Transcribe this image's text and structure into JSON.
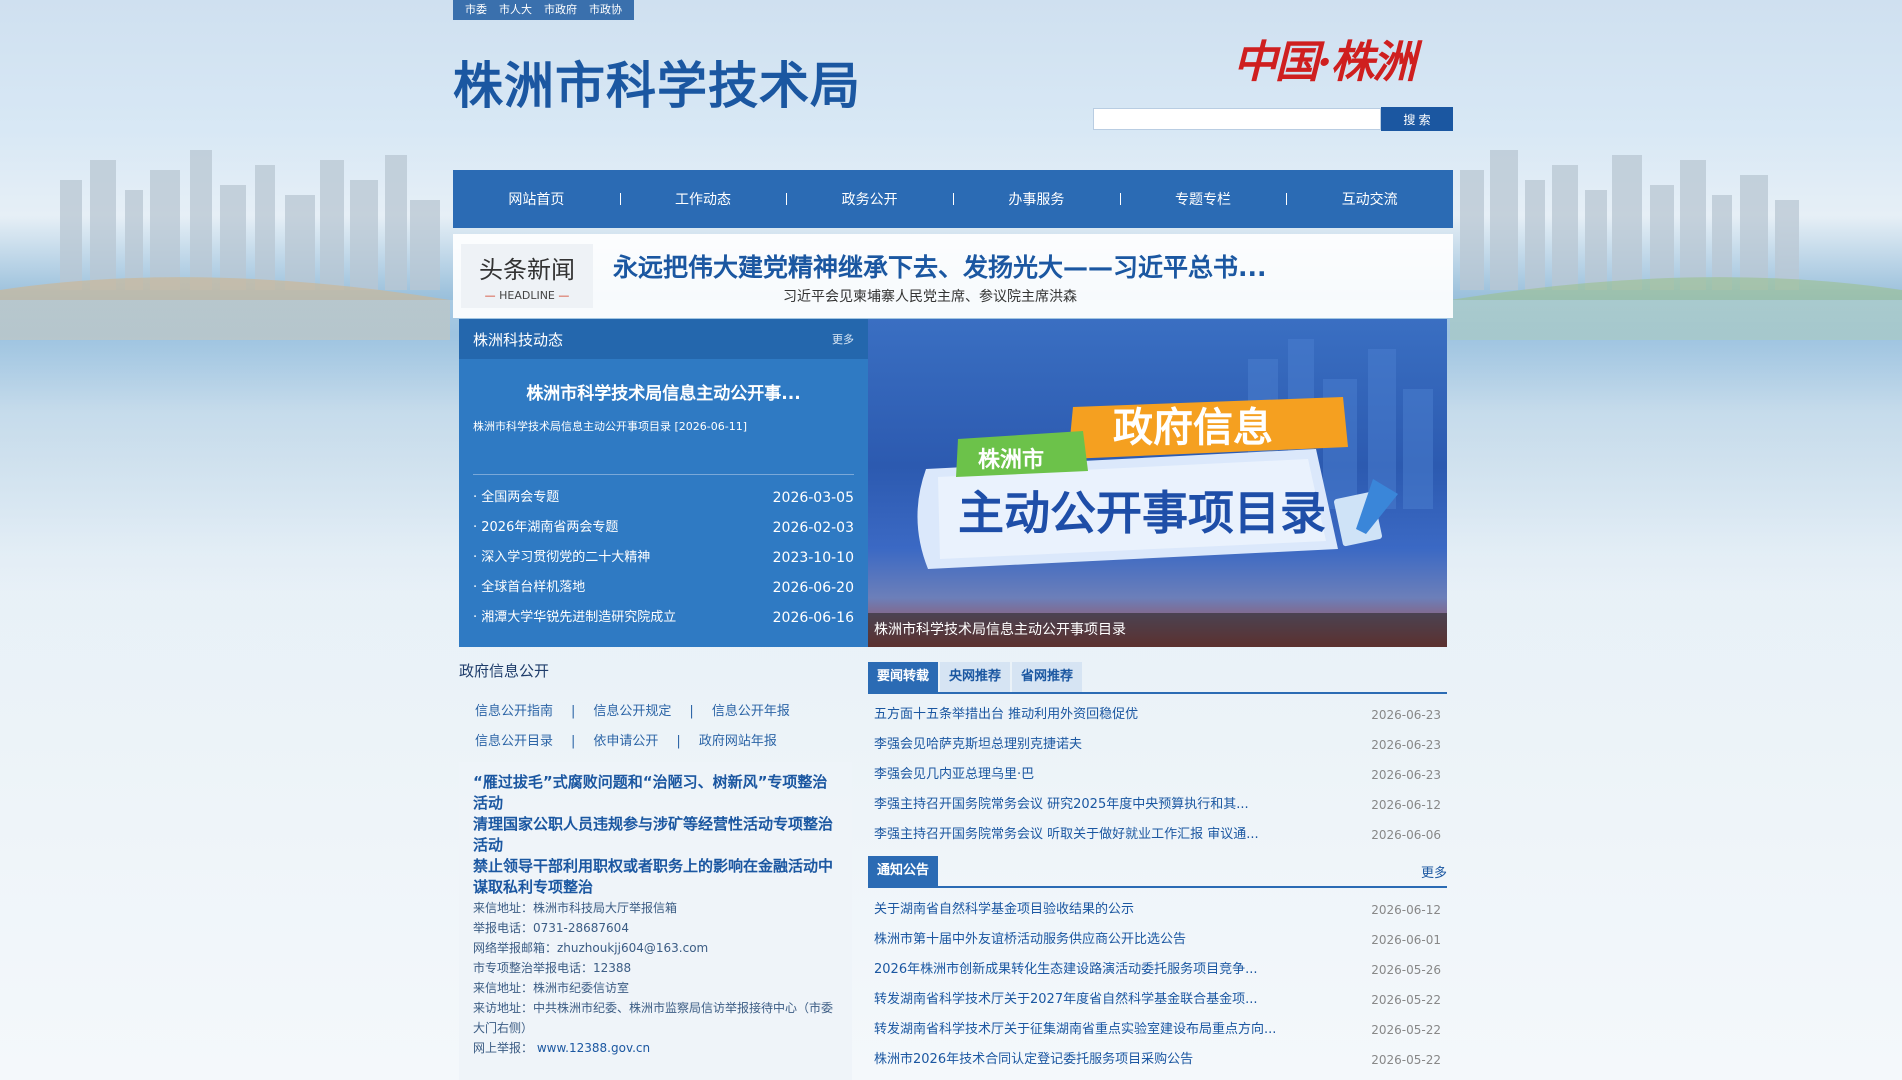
{
  "top_links": [
    "市委",
    "市人大",
    "市政府",
    "市政协"
  ],
  "site": {
    "title": "株洲市科学技术局",
    "calligraphy": "中国·株洲",
    "search_label": "搜 索",
    "search_value": ""
  },
  "nav": [
    "网站首页",
    "工作动态",
    "政务公开",
    "办事服务",
    "专题专栏",
    "互动交流"
  ],
  "headline": {
    "label_cn": "头条新闻",
    "label_en": "HEADLINE",
    "title": "永远把伟大建党精神继承下去、发扬光大——习近平总书...",
    "subtitle": "习近平会见柬埔寨人民党主席、参议院主席洪森"
  },
  "dynamics": {
    "title": "株洲科技动态",
    "more": "更多",
    "lead_title": "株洲市科学技术局信息主动公开事...",
    "lead_summary": "株洲市科学技术局信息主动公开事项目录 [2026-06-11]",
    "items": [
      {
        "title": "· 全国两会专题",
        "date": "2026-03-05"
      },
      {
        "title": "· 2026年湖南省两会专题",
        "date": "2026-02-03"
      },
      {
        "title": "· 深入学习贯彻党的二十大精神",
        "date": "2023-10-10"
      },
      {
        "title": "· 全球首台样机落地",
        "date": "2026-06-20"
      },
      {
        "title": "· 湘潭大学华锐先进制造研究院成立",
        "date": "2026-06-16"
      }
    ]
  },
  "banner": {
    "tag": "株洲市",
    "line1": "政府信息",
    "line2": "主动公开事项目录",
    "caption": "株洲市科学技术局信息主动公开事项目录"
  },
  "gov_info": {
    "title": "政府信息公开",
    "links_row1": [
      "信息公开指南",
      "信息公开规定",
      "信息公开年报"
    ],
    "links_row2": [
      "信息公开目录",
      "依申请公开",
      "政府网站年报"
    ],
    "separator": "|"
  },
  "report": {
    "links": [
      "“雁过拔毛”式腐败问题和“治陋习、树新风”专项整治活动",
      "清理国家公职人员违规参与涉矿等经营性活动专项整治活动",
      "禁止领导干部利用职权或者职务上的影响在金融活动中谋取私利专项整治"
    ],
    "info": [
      "来信地址：株洲市科技局大厅举报信箱",
      "举报电话：0731-28687604",
      "网络举报邮箱：zhuzhoukjj604@163.com",
      "市专项整治举报电话：12388",
      "来信地址：株洲市纪委信访室",
      "来访地址：中共株洲市纪委、株洲市监察局信访举报接待中心（市委大门右侧）"
    ],
    "web_label": "网上举报：",
    "web_url": "www.12388.gov.cn"
  },
  "news_tabs": [
    "要闻转载",
    "央网推荐",
    "省网推荐"
  ],
  "news_list": [
    {
      "title": "五方面十五条举措出台 推动利用外资回稳促优",
      "date": "2026-06-23"
    },
    {
      "title": "李强会见哈萨克斯坦总理别克捷诺夫",
      "date": "2026-06-23"
    },
    {
      "title": "李强会见几内亚总理乌里·巴",
      "date": "2026-06-23"
    },
    {
      "title": "李强主持召开国务院常务会议 研究2025年度中央预算执行和其...",
      "date": "2026-06-12"
    },
    {
      "title": "李强主持召开国务院常务会议 听取关于做好就业工作汇报 审议通...",
      "date": "2026-06-06"
    }
  ],
  "notice": {
    "tab": "通知公告",
    "more": "更多",
    "items": [
      {
        "title": "关于湖南省自然科学基金项目验收结果的公示",
        "date": "2026-06-12"
      },
      {
        "title": "株洲市第十届中外友谊桥活动服务供应商公开比选公告",
        "date": "2026-06-01"
      },
      {
        "title": "2026年株洲市创新成果转化生态建设路演活动委托服务项目竞争...",
        "date": "2026-05-26"
      },
      {
        "title": "转发湖南省科学技术厅关于2027年度省自然科学基金联合基金项...",
        "date": "2026-05-22"
      },
      {
        "title": "转发湖南省科学技术厅关于征集湖南省重点实验室建设布局重点方向...",
        "date": "2026-05-22"
      },
      {
        "title": "株洲市2026年技术合同认定登记委托服务项目采购公告",
        "date": "2026-05-22"
      }
    ]
  },
  "colors": {
    "brand_blue": "#1b57a1",
    "nav_blue": "#2b6bb4",
    "panel_blue": "#2f7ac3",
    "accent_red": "#cf1f1f"
  }
}
